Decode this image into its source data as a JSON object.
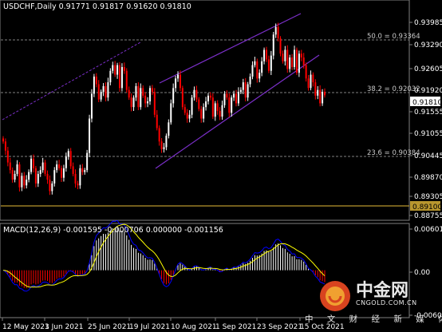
{
  "chart_data": [
    {
      "type": "candlestick",
      "symbol": "USDCHF,Daily",
      "ohlc_header": "0.91771 0.91817 0.91620 0.91810",
      "current_price_label": "0.91810",
      "horizontal_level_label": "0.89100",
      "price_ticks": [
        "0.93985",
        "0.93290",
        "0.92605",
        "0.91920",
        "0.91555",
        "0.91055",
        "0.90445",
        "0.89870",
        "0.89305",
        "0.88755"
      ],
      "fib_levels": [
        {
          "label": "50.0 = 0.93364",
          "value": 0.93364
        },
        {
          "label": "38.2 = 0.92032",
          "value": 0.92032
        },
        {
          "label": "23.6 = 0.90384",
          "value": 0.90384
        }
      ],
      "date_labels": [
        "12 May 2021",
        "3 Jun 2021",
        "25 Jun 2021",
        "19 Jul 2021",
        "10 Aug 2021",
        "1 Sep 2021",
        "23 Sep 2021",
        "15 Oct 2021"
      ],
      "ylim": [
        0.8862,
        0.9418
      ],
      "candles_close": [
        0.906,
        0.9036,
        0.9005,
        0.8985,
        0.896,
        0.8975,
        0.9,
        0.894,
        0.897,
        0.8945,
        0.896,
        0.898,
        0.9015,
        0.899,
        0.895,
        0.8975,
        0.8985,
        0.9005,
        0.8975,
        0.896,
        0.893,
        0.895,
        0.8985,
        0.9,
        0.899,
        0.8965,
        0.899,
        0.902,
        0.9035,
        0.8995,
        0.8975,
        0.895,
        0.8945,
        0.899,
        0.898,
        0.8985,
        0.903,
        0.912,
        0.9185,
        0.923,
        0.921,
        0.917,
        0.919,
        0.9205,
        0.9175,
        0.9215,
        0.9245,
        0.926,
        0.9235,
        0.926,
        0.92,
        0.9255,
        0.9245,
        0.9195,
        0.9175,
        0.915,
        0.9175,
        0.9205,
        0.915,
        0.92,
        0.918,
        0.916,
        0.9165,
        0.92,
        0.919,
        0.913,
        0.9095,
        0.906,
        0.904,
        0.9045,
        0.9075,
        0.911,
        0.916,
        0.92,
        0.9225,
        0.9235,
        0.92,
        0.915,
        0.9135,
        0.912,
        0.913,
        0.9175,
        0.9195,
        0.917,
        0.9145,
        0.912,
        0.915,
        0.9165,
        0.918,
        0.9175,
        0.9125,
        0.916,
        0.914,
        0.9125,
        0.9155,
        0.9185,
        0.9175,
        0.9135,
        0.9175,
        0.9185,
        0.916,
        0.919,
        0.9195,
        0.9215,
        0.9175,
        0.921,
        0.923,
        0.926,
        0.927,
        0.9225,
        0.924,
        0.927,
        0.93,
        0.9275,
        0.9245,
        0.9285,
        0.934,
        0.936,
        0.933,
        0.929,
        0.927,
        0.93,
        0.925,
        0.928,
        0.9255,
        0.93,
        0.924,
        0.929,
        0.928,
        0.926,
        0.9225,
        0.92,
        0.9235,
        0.9215,
        0.918,
        0.9195,
        0.916,
        0.919,
        0.9181
      ],
      "macd": {
        "label": "MACD(12,26,9) -0.001595 -0.000706 0.000000 -0.001156",
        "ticks": [
          "0.006013",
          "0.00",
          "-0.006092"
        ],
        "ylim": [
          -0.006092,
          0.006013
        ]
      }
    }
  ],
  "watermark": {
    "cn": "中金网",
    "en": "CNGOLD.COM.CN",
    "slogan": "中 文 财 经 新 媒 体"
  },
  "colors": {
    "background": "#000000",
    "bull": "#ffffff",
    "bear": "#ff0000",
    "channel": "#7b2fc9",
    "macd_main": "#0000ff",
    "macd_signal": "#ffff00",
    "level_line": "#b8962e",
    "fib_line": "#808080"
  }
}
